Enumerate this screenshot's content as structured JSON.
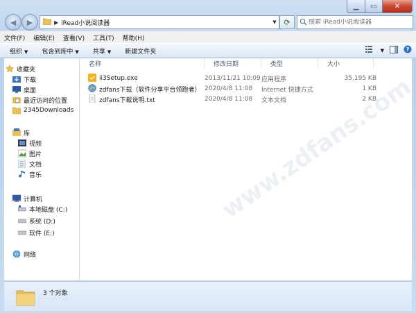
{
  "window": {
    "address_path": "iRead小说阅读器",
    "search_placeholder": "搜索 iRead小说阅读器"
  },
  "menu": [
    "文件(F)",
    "编辑(E)",
    "查看(V)",
    "工具(T)",
    "帮助(H)"
  ],
  "toolbar": {
    "organize": "组织",
    "include_in_library": "包含到库中",
    "share": "共享",
    "new_folder": "新建文件夹"
  },
  "nav": {
    "favorites": "收藏夹",
    "downloads": "下载",
    "desktop": "桌面",
    "recent": "最近访问的位置",
    "downloads2345": "2345Downloads",
    "libraries": "库",
    "videos": "视频",
    "pictures": "图片",
    "documents": "文档",
    "music": "音乐",
    "computer": "计算机",
    "local_disk_c": "本地磁盘 (C:)",
    "drive_d": "系统 (D:)",
    "drive_e": "软件 (E:)",
    "network": "网络"
  },
  "columns": {
    "name": "名称",
    "modified": "修改日期",
    "type": "类型",
    "size": "大小"
  },
  "files": [
    {
      "name": "ii3Setup.exe",
      "modified": "2013/11/21 10:09",
      "type": "应用程序",
      "size": "35,195 KB"
    },
    {
      "name": "zdfans下载（软件分享平台领跑者）",
      "modified": "2020/4/8 11:08",
      "type": "Internet 快捷方式",
      "size": "1 KB"
    },
    {
      "name": "zdfans下载说明.txt",
      "modified": "2020/4/8 11:08",
      "type": "文本文档",
      "size": "2 KB"
    }
  ],
  "status": {
    "count": "3 个对象"
  },
  "watermark": "www.zdfans.com",
  "colors": {
    "accent": "#c9ddef",
    "close": "#c7452f"
  }
}
